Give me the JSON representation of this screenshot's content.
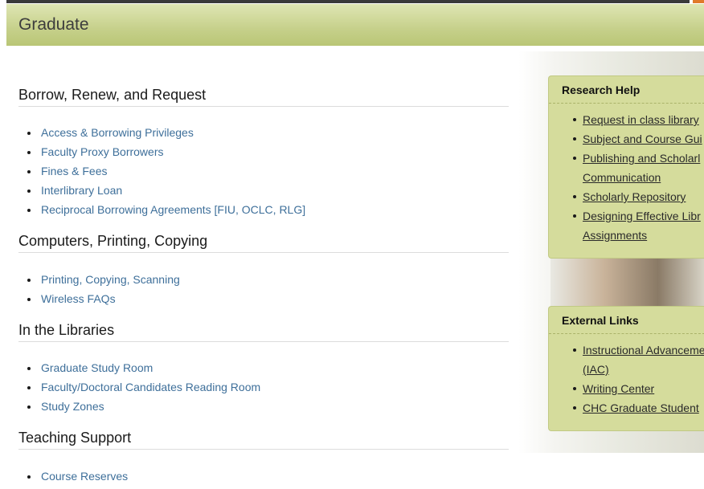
{
  "header": {
    "title": "Graduate"
  },
  "sections": [
    {
      "heading": "Borrow, Renew, and Request",
      "links": [
        "Access & Borrowing Privileges",
        "Faculty Proxy Borrowers",
        "Fines & Fees",
        "Interlibrary Loan",
        "Reciprocal Borrowing  Agreements [FIU, OCLC, RLG]"
      ]
    },
    {
      "heading": "Computers, Printing, Copying",
      "links": [
        "Printing, Copying, Scanning",
        "Wireless FAQs"
      ]
    },
    {
      "heading": "In the Libraries",
      "links": [
        "Graduate Study Room",
        "Faculty/Doctoral Candidates Reading Room",
        "Study Zones"
      ]
    },
    {
      "heading": "Teaching Support",
      "links": [
        "Course Reserves"
      ]
    }
  ],
  "sidebar": {
    "research_help": {
      "title": "Research Help",
      "links": [
        "Request in class library",
        "Subject and Course Gui",
        "Publishing and Scholarl",
        "Communication",
        "Scholarly Repository",
        "Designing Effective Libr",
        "Assignments"
      ]
    },
    "external_links": {
      "title": "External Links",
      "links": [
        "Instructional Advanceme",
        "(IAC)",
        "Writing Center",
        "CHC Graduate Student"
      ]
    }
  }
}
